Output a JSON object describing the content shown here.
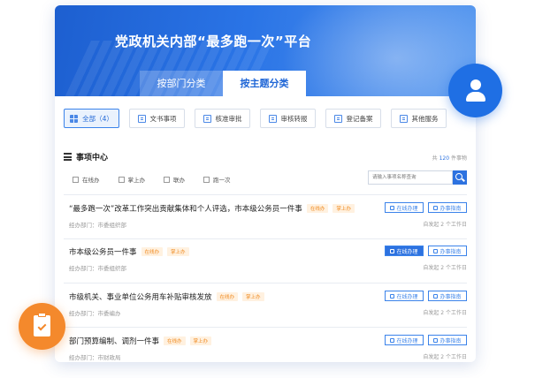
{
  "hero": {
    "title": "党政机关内部“最多跑一次”平台"
  },
  "tabs": [
    {
      "label": "按部门分类",
      "active": false
    },
    {
      "label": "按主题分类",
      "active": true
    }
  ],
  "filters": [
    {
      "label": "全部（4）",
      "icon": "grid-icon",
      "active": true
    },
    {
      "label": "文书事项",
      "icon": "document-icon",
      "active": false
    },
    {
      "label": "核准审批",
      "icon": "approval-icon",
      "active": false
    },
    {
      "label": "审核转报",
      "icon": "review-icon",
      "active": false
    },
    {
      "label": "登记备案",
      "icon": "register-icon",
      "active": false
    },
    {
      "label": "其他服务",
      "icon": "service-icon",
      "active": false
    }
  ],
  "section": {
    "title": "事项中心",
    "count_prefix": "共",
    "count_value": "120",
    "count_suffix": "件事物"
  },
  "checkboxes": [
    "在线办",
    "掌上办",
    "联办",
    "跑一次"
  ],
  "search": {
    "placeholder": "请输入事项名称查询"
  },
  "actions": {
    "online": "在线办理",
    "guide": "办事指南"
  },
  "items": [
    {
      "title": "“最多跑一次”改革工作突出贡献集体和个人评选，市本级公务员一件事",
      "tags": [
        "在线办",
        "掌上办"
      ],
      "dept": "经办部门：市委组织部",
      "meta": "自发起 2 个工作日"
    },
    {
      "title": "市本级公务员一件事",
      "tags": [
        "在线办",
        "掌上办"
      ],
      "dept": "经办部门：市委组织部",
      "meta": "自发起 2 个工作日"
    },
    {
      "title": "市级机关、事业单位公务用车补贴审核发放",
      "tags": [
        "在线办",
        "掌上办"
      ],
      "dept": "经办部门：市委编办",
      "meta": "自发起 2 个工作日"
    },
    {
      "title": "部门预算编制、调剂一件事",
      "tags": [
        "在线办",
        "掌上办"
      ],
      "dept": "经办部门：市财政局",
      "meta": "自发起 2 个工作日"
    }
  ],
  "colors": {
    "primary": "#2d72e0",
    "accent_orange": "#f4892c",
    "tag_text": "#f08a1f"
  }
}
